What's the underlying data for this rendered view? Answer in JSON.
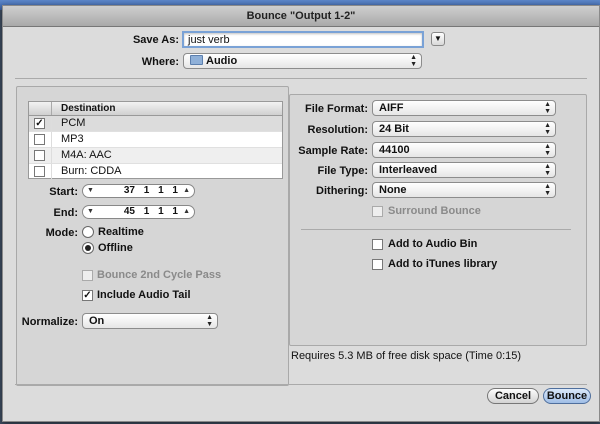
{
  "window": {
    "title": "Bounce \"Output 1-2\""
  },
  "save": {
    "save_as_label": "Save As:",
    "filename": "just verb",
    "where_label": "Where:",
    "where_value": "Audio"
  },
  "destination": {
    "header": "Destination",
    "items": [
      {
        "label": "PCM",
        "checked": true
      },
      {
        "label": "MP3",
        "checked": false
      },
      {
        "label": "M4A: AAC",
        "checked": false
      },
      {
        "label": "Burn: CDDA",
        "checked": false
      }
    ]
  },
  "range": {
    "start_label": "Start:",
    "start_value": "37 1 1 1",
    "end_label": "End:",
    "end_value": "45 1 1 1"
  },
  "mode": {
    "label": "Mode:",
    "options": [
      {
        "label": "Realtime",
        "selected": false
      },
      {
        "label": "Offline",
        "selected": true
      }
    ]
  },
  "options": {
    "bounce_2nd_cycle": "Bounce 2nd Cycle Pass",
    "include_audio_tail": "Include Audio Tail"
  },
  "normalize": {
    "label": "Normalize:",
    "value": "On"
  },
  "format": {
    "file_format_label": "File Format:",
    "file_format_value": "AIFF",
    "resolution_label": "Resolution:",
    "resolution_value": "24 Bit",
    "sample_rate_label": "Sample Rate:",
    "sample_rate_value": "44100",
    "file_type_label": "File Type:",
    "file_type_value": "Interleaved",
    "dithering_label": "Dithering:",
    "dithering_value": "None",
    "surround_bounce": "Surround Bounce",
    "add_to_audio_bin": "Add to Audio Bin",
    "add_to_itunes": "Add to iTunes library"
  },
  "status": {
    "disk_space": "Requires 5.3 MB of free disk space  (Time 0:15)"
  },
  "buttons": {
    "cancel": "Cancel",
    "bounce": "Bounce"
  },
  "icons": {
    "checkmark": "✓",
    "folder": "folder-icon",
    "up_arrow": "▲",
    "down_arrow": "▼",
    "expand": "▼"
  }
}
